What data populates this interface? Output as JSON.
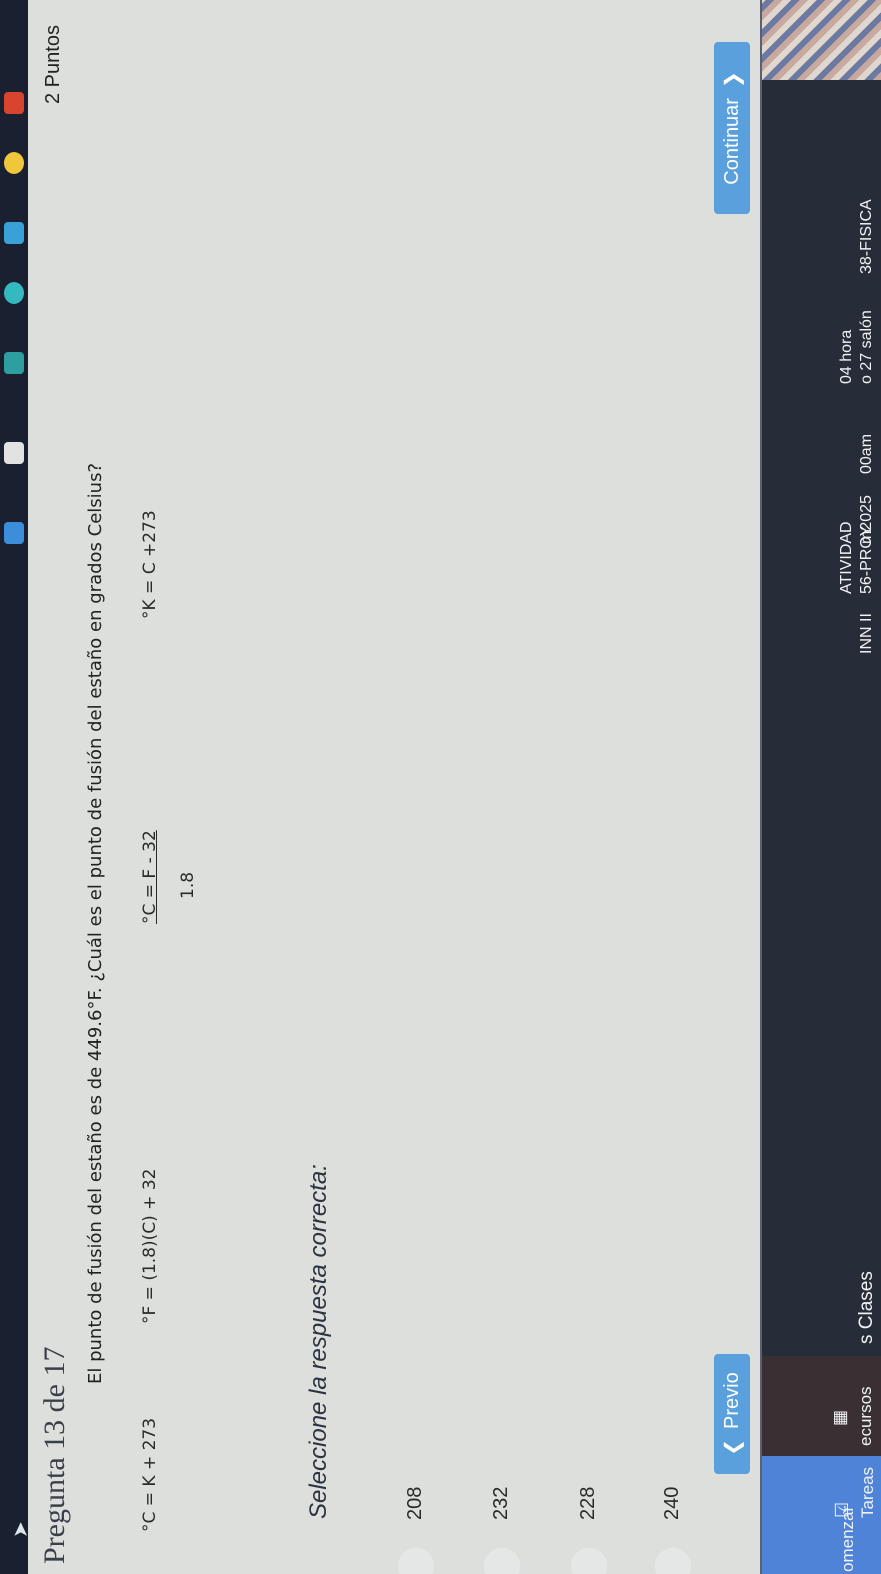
{
  "header": {
    "title": "Pregunta 13 de 17",
    "points": "2 Puntos"
  },
  "question": {
    "text": "El punto de fusión del estaño es de 449.6°F. ¿Cuál es el punto de fusión del estaño en grados Celsius?",
    "formula_1": "°C = K + 273",
    "formula_2": "°F = (1.8)(C) + 32",
    "formula_3_num": "°C = F - 32",
    "formula_3_den": "1.8",
    "formula_4": "°K = C +273"
  },
  "instruction": "Seleccione la respuesta correcta:",
  "options": [
    {
      "label": "208"
    },
    {
      "label": "232"
    },
    {
      "label": "228"
    },
    {
      "label": "240"
    }
  ],
  "nav": {
    "prev_label": "Previo",
    "next_label": "Continuar"
  },
  "sidebar": {
    "items": [
      "omenzar",
      "Tareas",
      "ecursos",
      "s Clases",
      "38-FISICA",
      "o 27 salón",
      "04 hora",
      "00am",
      "m2025",
      "56-PROY",
      "ATIVIDAD",
      "INN II"
    ]
  },
  "colors": {
    "accent": "#5aa0dc",
    "sidebar_active": "#4f83d8",
    "sidebar_bg": "#262c38"
  }
}
